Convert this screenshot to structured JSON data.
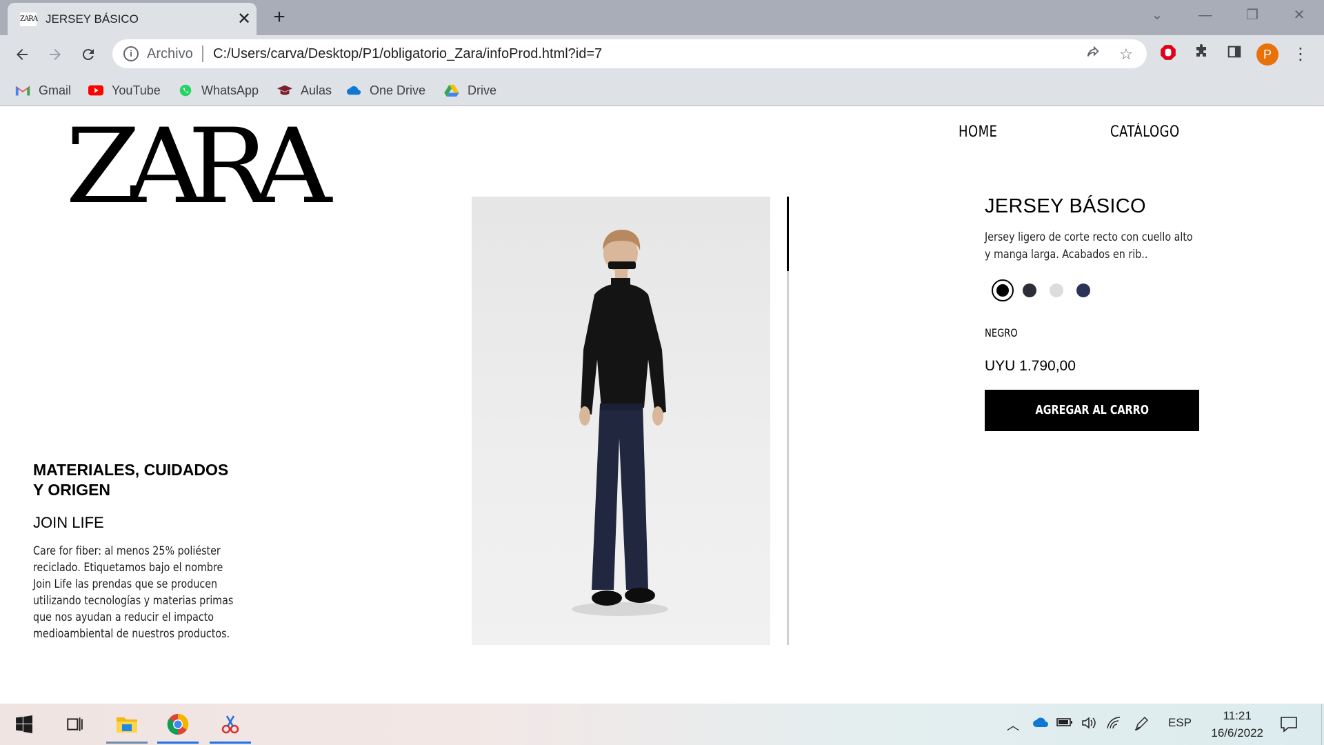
{
  "browser": {
    "tab_title": "JERSEY BÁSICO",
    "tab_favicon_text": "ZARA",
    "tab_close": "✕",
    "new_tab": "+",
    "url_scheme": "Archivo",
    "url": "C:/Users/carva/Desktop/P1/obligatorio_Zara/infoProd.html?id=7",
    "profile_initial": "P",
    "window_controls": [
      "⌄",
      "—",
      "❐",
      "✕"
    ]
  },
  "bookmarks": [
    {
      "label": "Gmail",
      "color": "#ea4335",
      "icon": "gmail-icon"
    },
    {
      "label": "YouTube",
      "color": "#ff0000",
      "icon": "youtube-icon"
    },
    {
      "label": "WhatsApp",
      "color": "#25d366",
      "icon": "whatsapp-icon"
    },
    {
      "label": "Aulas",
      "color": "#7b1f2a",
      "icon": "graduation-cap-icon"
    },
    {
      "label": "One Drive",
      "color": "#0f78d4",
      "icon": "onedrive-cloud-icon"
    },
    {
      "label": "Drive",
      "color": "#34a853",
      "icon": "google-drive-icon"
    }
  ],
  "site": {
    "logo": "ZARA",
    "nav": {
      "home": "HOME",
      "catalog": "CATÁLOGO"
    }
  },
  "materials": {
    "title": "MATERIALES, CUIDADOS Y ORIGEN",
    "subtitle": "JOIN LIFE",
    "body": "Care for fiber: al menos 25% poliéster reciclado. Etiquetamos bajo el nombre Join Life las prendas que se producen utilizando tecnologías y materias primas que nos ayudan a reducir el impacto medioambiental de nuestros productos."
  },
  "product": {
    "title": "JERSEY BÁSICO",
    "description": "Jersey ligero de corte recto con cuello alto y manga larga. Acabados en rib..",
    "colors": [
      "#000000",
      "#2b2e36",
      "#dcdcdc",
      "#2a3256"
    ],
    "selected_color_index": 0,
    "color_name": "NEGRO",
    "price": "UYU 1.790,00",
    "cart_button": "AGREGAR AL CARRO"
  },
  "taskbar": {
    "language": "ESP",
    "time": "11:21",
    "date": "16/6/2022"
  }
}
